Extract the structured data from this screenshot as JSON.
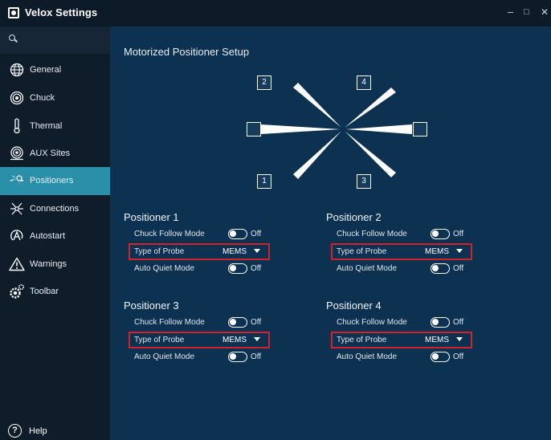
{
  "window": {
    "title": "Velox Settings",
    "controls": {
      "minimize": "–",
      "maximize": "□",
      "close": "✕"
    }
  },
  "sidebar": {
    "search_icon": "search-icon",
    "items": [
      {
        "label": "General",
        "icon": "globe-icon",
        "active": false
      },
      {
        "label": "Chuck",
        "icon": "target-icon",
        "active": false
      },
      {
        "label": "Thermal",
        "icon": "thermometer-icon",
        "active": false
      },
      {
        "label": "AUX Sites",
        "icon": "aux-sites-icon",
        "active": false
      },
      {
        "label": "Positioners",
        "icon": "positioners-icon",
        "active": true
      },
      {
        "label": "Connections",
        "icon": "connections-icon",
        "active": false
      },
      {
        "label": "Autostart",
        "icon": "autostart-icon",
        "active": false
      },
      {
        "label": "Warnings",
        "icon": "warning-icon",
        "active": false
      },
      {
        "label": "Toolbar",
        "icon": "toolbar-gear-icon",
        "active": false
      }
    ],
    "help_label": "Help",
    "help_glyph": "?"
  },
  "main": {
    "title": "Motorized Positioner Setup",
    "diagram": {
      "labels": [
        "1",
        "2",
        "3",
        "4"
      ]
    },
    "positioners": [
      {
        "title": "Positioner 1",
        "chuck_follow_label": "Chuck Follow Mode",
        "chuck_follow_value": "Off",
        "probe_label": "Type of Probe",
        "probe_value": "MEMS",
        "auto_quiet_label": "Auto Quiet Mode",
        "auto_quiet_value": "Off"
      },
      {
        "title": "Positioner 2",
        "chuck_follow_label": "Chuck Follow Mode",
        "chuck_follow_value": "Off",
        "probe_label": "Type of Probe",
        "probe_value": "MEMS",
        "auto_quiet_label": "Auto Quiet Mode",
        "auto_quiet_value": "Off"
      },
      {
        "title": "Positioner 3",
        "chuck_follow_label": "Chuck Follow Mode",
        "chuck_follow_value": "Off",
        "probe_label": "Type of Probe",
        "probe_value": "MEMS",
        "auto_quiet_label": "Auto Quiet Mode",
        "auto_quiet_value": "Off"
      },
      {
        "title": "Positioner 4",
        "chuck_follow_label": "Chuck Follow Mode",
        "chuck_follow_value": "Off",
        "probe_label": "Type of Probe",
        "probe_value": "MEMS",
        "auto_quiet_label": "Auto Quiet Mode",
        "auto_quiet_value": "Off"
      }
    ]
  },
  "colors": {
    "sidebar_bg": "#0f1c2a",
    "main_bg": "#0d3150",
    "active_item": "#2a8fa8",
    "highlight_border": "#d2212b"
  }
}
